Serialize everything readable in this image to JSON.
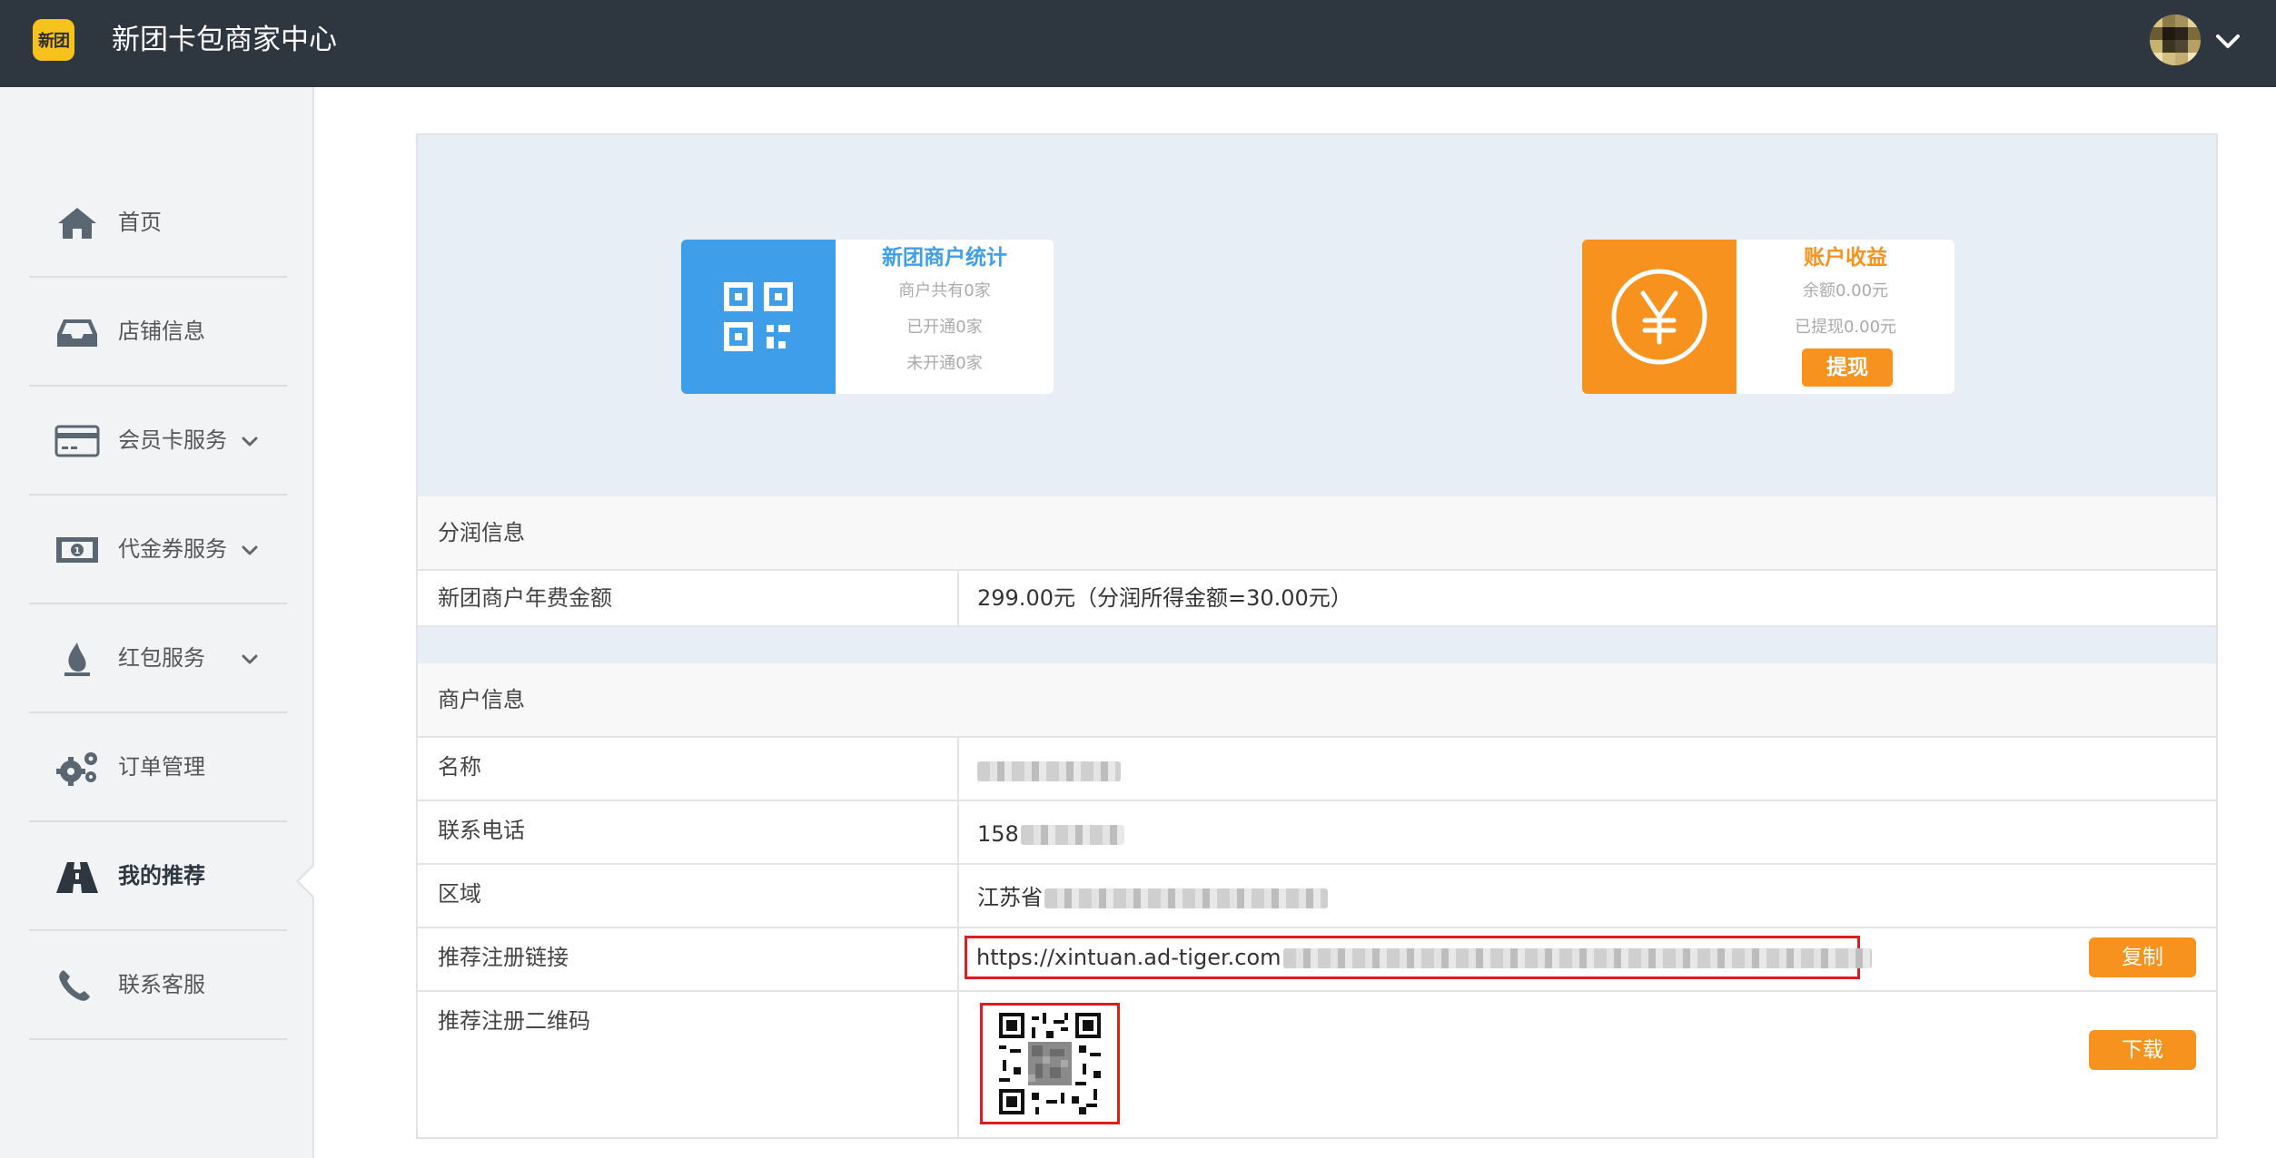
{
  "app": {
    "logo_text": "新团",
    "title": "新团卡包商家中心"
  },
  "sidebar": {
    "items": [
      {
        "label": "首页",
        "icon": "home-icon",
        "expandable": false,
        "active": false
      },
      {
        "label": "店铺信息",
        "icon": "inbox-icon",
        "expandable": false,
        "active": false
      },
      {
        "label": "会员卡服务",
        "icon": "credit-card-icon",
        "expandable": true,
        "active": false
      },
      {
        "label": "代金券服务",
        "icon": "banknote-icon",
        "expandable": true,
        "active": false
      },
      {
        "label": "红包服务",
        "icon": "fire-icon",
        "expandable": true,
        "active": false
      },
      {
        "label": "订单管理",
        "icon": "gears-icon",
        "expandable": false,
        "active": false
      },
      {
        "label": "我的推荐",
        "icon": "road-icon",
        "expandable": false,
        "active": true
      },
      {
        "label": "联系客服",
        "icon": "phone-icon",
        "expandable": false,
        "active": false
      }
    ]
  },
  "stats_card": {
    "title": "新团商户统计",
    "lines": [
      "商户共有0家",
      "已开通0家",
      "未开通0家"
    ],
    "color": "#3f9ee9",
    "icon": "qrcode-icon"
  },
  "earnings_card": {
    "title": "账户收益",
    "lines": [
      "余额0.00元",
      "已提现0.00元"
    ],
    "withdraw_label": "提现",
    "color": "#f7921e",
    "icon": "yen-icon"
  },
  "profit_section": {
    "title": "分润信息",
    "rows": [
      {
        "label": "新团商户年费金额",
        "value": "299.00元（分润所得金额=30.00元）"
      }
    ]
  },
  "merchant_section": {
    "title": "商户信息",
    "name_label": "名称",
    "phone_label": "联系电话",
    "phone_value": "158",
    "region_label": "区域",
    "region_value": "江苏省",
    "link_label": "推荐注册链接",
    "link_value": "https://xintuan.ad-tiger.com",
    "copy_label": "复制",
    "qr_label": "推荐注册二维码",
    "download_label": "下载"
  },
  "colors": {
    "topbar": "#2e3640",
    "accent_blue": "#3f9ee9",
    "accent_orange": "#f7921e",
    "highlight_red": "#e01c1c"
  }
}
